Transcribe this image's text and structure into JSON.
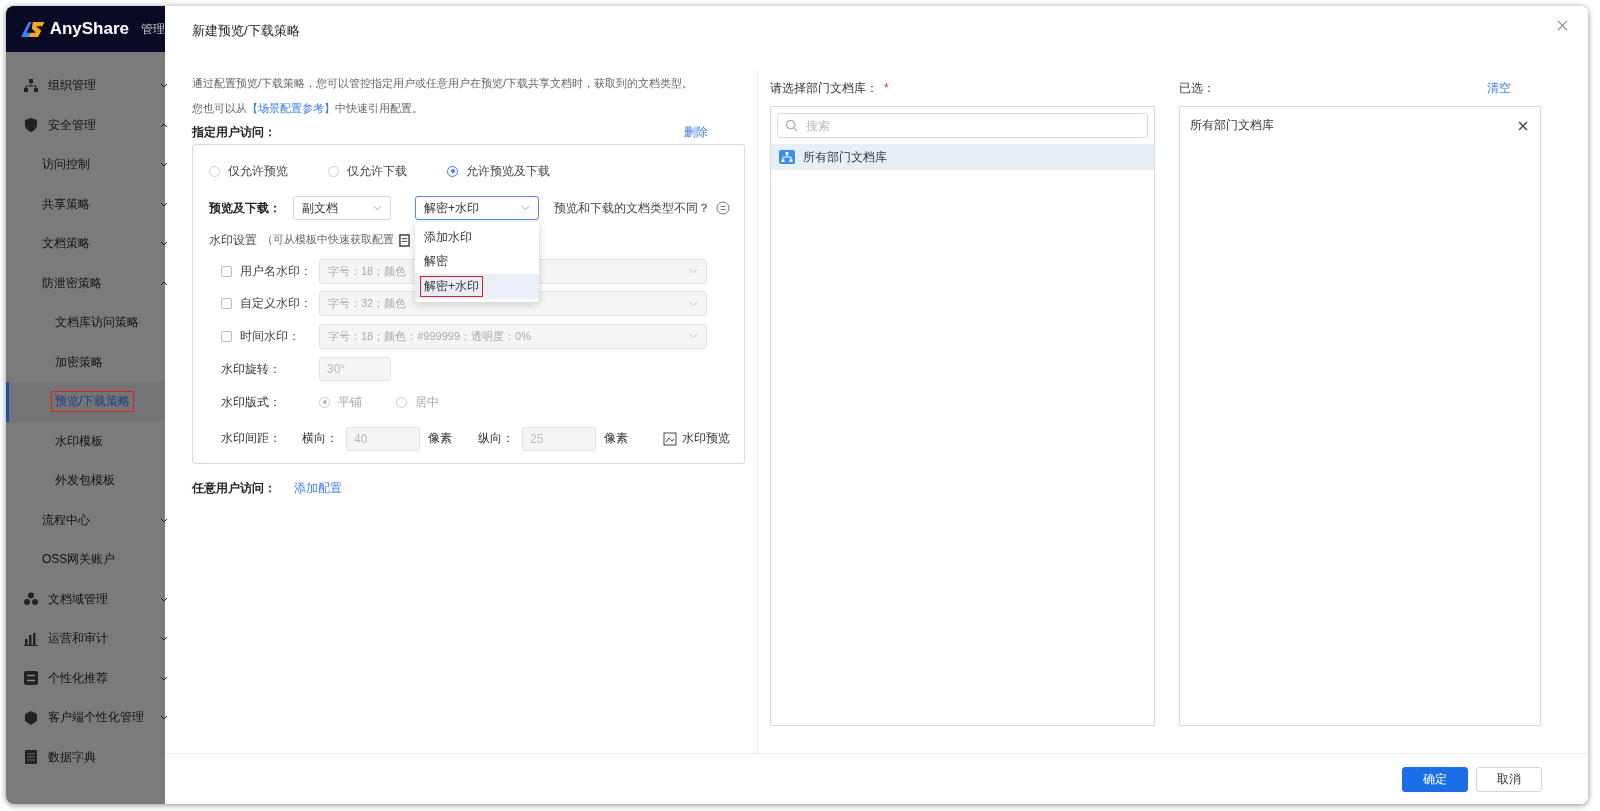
{
  "sidebar": {
    "brand": "AnyShare",
    "brand_cut": "管理",
    "items": [
      {
        "label": "组织管理",
        "expanded": false,
        "selected": false
      },
      {
        "label": "安全管理",
        "expanded": true,
        "selected": false,
        "children": [
          {
            "label": "访问控制",
            "expanded": false,
            "selected": false
          },
          {
            "label": "共享策略",
            "expanded": false,
            "selected": false
          },
          {
            "label": "文档策略",
            "expanded": false,
            "selected": false
          },
          {
            "label": "防泄密策略",
            "expanded": true,
            "selected": false,
            "children": [
              {
                "label": "文档库访问策略",
                "selected": false
              },
              {
                "label": "加密策略",
                "selected": false
              },
              {
                "label": "预览/下载策略",
                "selected": true,
                "annotated": true
              },
              {
                "label": "水印模板",
                "selected": false
              },
              {
                "label": "外发包模板",
                "selected": false
              }
            ]
          },
          {
            "label": "流程中心",
            "expanded": false,
            "selected": false
          },
          {
            "label": "OSS网关账户",
            "selected": false
          }
        ]
      },
      {
        "label": "文档域管理",
        "expanded": false,
        "selected": false
      },
      {
        "label": "运营和审计",
        "expanded": false,
        "selected": false
      },
      {
        "label": "个性化推荐",
        "expanded": false,
        "selected": false
      },
      {
        "label": "客户端个性化管理",
        "expanded": false,
        "selected": false
      },
      {
        "label": "数据字典",
        "selected": false
      }
    ]
  },
  "dialog": {
    "title": "新建预览/下载策略",
    "intro": "通过配置预览/下载策略，您可以管控指定用户或任意用户在预览/下载共享文档时，获取到的文档类型。",
    "ref": {
      "prefix": "您也可以从",
      "link": "【场景配置参考】",
      "suffix": "中快速引用配置。"
    },
    "specified": {
      "title": "指定用户访问：",
      "action": "删除",
      "radios": [
        {
          "label": "仅允许预览",
          "selected": false
        },
        {
          "label": "仅允许下载",
          "selected": false
        },
        {
          "label": "允许预览及下载",
          "selected": true
        }
      ],
      "mode": {
        "label": "预览及下载：",
        "doc_type": "副文档",
        "process": "解密+水印",
        "help": "预览和下载的文档类型不同？",
        "options": [
          {
            "label": "添加水印",
            "selected": false,
            "annotated": false
          },
          {
            "label": "解密",
            "selected": false,
            "annotated": false
          },
          {
            "label": "解密+水印",
            "selected": true,
            "annotated": true
          }
        ]
      },
      "watermark": {
        "title": "水印设置",
        "hint": "（可从模板中快速获取配置",
        "rows": [
          {
            "label": "用户名水印：",
            "checked": false,
            "value": "字号：18；颜色"
          },
          {
            "label": "自定义水印：",
            "checked": false,
            "value": "字号：32；颜色"
          },
          {
            "label": "时间水印：",
            "checked": false,
            "value": "字号：18；颜色：#999999；透明度：0%"
          }
        ],
        "rotation": {
          "label": "水印旋转：",
          "value": "30°"
        },
        "layout": {
          "label": "水印版式：",
          "options": [
            {
              "label": "平铺",
              "selected": true
            },
            {
              "label": "居中",
              "selected": false
            }
          ]
        },
        "spacing": {
          "label": "水印间距：",
          "h_label": "横向：",
          "h_value": "40",
          "h_unit": "像素",
          "v_label": "纵向：",
          "v_value": "25",
          "v_unit": "像素"
        },
        "preview": "水印预览"
      }
    },
    "anyone": {
      "title": "任意用户访问：",
      "action": "添加配置"
    },
    "library": {
      "label": "请选择部门文档库：",
      "required": "*",
      "search_placeholder": "搜索",
      "items": [
        {
          "label": "所有部门文档库",
          "selected": true
        }
      ]
    },
    "chosen": {
      "label": "已选：",
      "action": "清空",
      "items": [
        {
          "label": "所有部门文档库"
        }
      ]
    },
    "buttons": [
      {
        "label": "确定",
        "kind": "primary"
      },
      {
        "label": "取消",
        "kind": "default"
      }
    ]
  }
}
